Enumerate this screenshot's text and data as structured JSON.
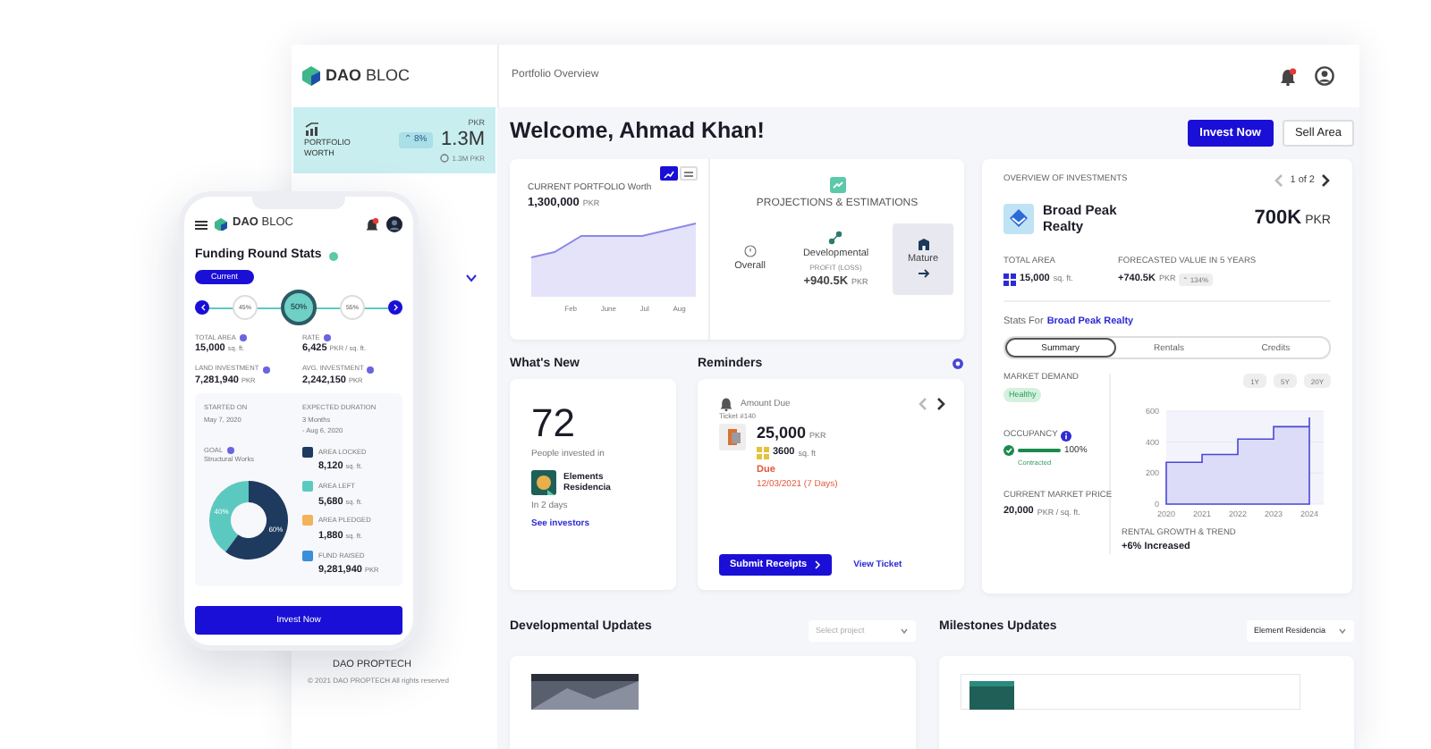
{
  "header": {
    "logo": "**DAO** BLOC",
    "breadcrumb": "Portfolio Overview"
  },
  "portfolio_worth": {
    "label": "PORTFOLIO WORTH",
    "change": "⌃ 8%",
    "currency": "PKR",
    "value": "1.3M",
    "sub_value": "1.3M PKR"
  },
  "sidebar_footer": {
    "brand": "DAO PROPTECH",
    "copyright": "© 2021 DAO PROPTECH All rights reserved"
  },
  "welcome": "Welcome, Ahmad Khan!",
  "actions": [
    {
      "label": "Invest Now",
      "kind": "primary"
    },
    {
      "label": "Sell Area",
      "kind": "secondary"
    }
  ],
  "portfolio_chart": {
    "view_toggle": [
      {
        "kind": "chart",
        "selected": true
      },
      {
        "kind": "list",
        "selected": false
      }
    ],
    "title": "CURRENT PORTFOLIO Worth",
    "value": "1,300,000",
    "currency": "PKR",
    "x_labels": [
      "Feb",
      "June",
      "Jul",
      "Aug"
    ]
  },
  "projections": {
    "title": "PROJECTIONS & ESTIMATIONS",
    "options": [
      {
        "label": "Overall",
        "kind": "overall",
        "selected": false
      },
      {
        "label": "Developmental",
        "kind": "developmental",
        "selected": false,
        "profit_label": "PROFIT (LOSS)",
        "profit_value": "+940.5K",
        "currency": "PKR"
      },
      {
        "label": "Mature",
        "kind": "mature",
        "selected": true
      }
    ]
  },
  "overview": {
    "title": "OVERVIEW OF INVESTMENTS",
    "pager": "1 of 2",
    "name": "Broad Peak Realty",
    "value": "700K",
    "currency": "PKR",
    "total_area_label": "TOTAL AREA",
    "total_area": "15,000",
    "total_area_unit": "sq. ft.",
    "forecast_label": "FORECASTED VALUE IN 5 YEARS",
    "forecast": "+740.5K",
    "forecast_unit": "PKR",
    "forecast_change": "⌃ 134%",
    "stats_prefix": "Stats For",
    "stats_link": "Broad Peak Realty",
    "tabs": [
      {
        "label": "Summary",
        "selected": true
      },
      {
        "label": "Rentals",
        "selected": false
      },
      {
        "label": "Credits",
        "selected": false
      }
    ],
    "market_demand_label": "MARKET DEMAND",
    "market_demand": "Healthy",
    "occupancy_label": "OCCUPANCY",
    "occupancy": {
      "level": 1,
      "reading": "100%",
      "status": "Contracted"
    },
    "price_label": "CURRENT MARKET PRICE",
    "price": "20,000",
    "price_unit": "PKR / sq. ft.",
    "ranges": [
      {
        "label": "1Y",
        "selected": false
      },
      {
        "label": "5Y",
        "selected": false
      },
      {
        "label": "20Y",
        "selected": false
      }
    ],
    "chart_data": {
      "type": "area",
      "x": [
        2020,
        2021,
        2022,
        2023,
        2024
      ],
      "values": [
        270,
        320,
        420,
        500,
        560
      ],
      "xlim": [
        2020,
        2024.4
      ],
      "ylim": [
        0,
        600
      ],
      "yticks": [
        0,
        200,
        400,
        600
      ],
      "xticks": [
        2020,
        2021,
        2022,
        2023,
        2024
      ]
    },
    "trend_label": "RENTAL GROWTH & TREND",
    "trend": "+6% Increased"
  },
  "whats_new": {
    "title": "What's New",
    "count": "72",
    "caption": "People invested in",
    "project": "Elements Residencia",
    "when": "In 2 days",
    "link": "See investors"
  },
  "reminders": {
    "title": "Reminders",
    "type": "Amount Due",
    "ticket": "Ticket #140",
    "amount": "25,000",
    "currency": "PKR",
    "area": "3600",
    "area_unit": "sq. ft",
    "status": "Due",
    "due_date": "12/03/2021 (7 Days)",
    "primary": "Submit Receipts",
    "secondary": "View Ticket"
  },
  "updates": [
    {
      "title": "Developmental Updates",
      "select": {
        "placeholder": "Select project"
      }
    },
    {
      "title": "Milestones Updates",
      "select": {
        "value": "Element Residencia"
      }
    }
  ],
  "phone": {
    "logo": "**DAO** BLOC",
    "title": "Funding Round Stats",
    "current": "Current",
    "steps": [
      {
        "label": "45%",
        "selected": false
      },
      {
        "label": "50%",
        "selected": true
      },
      {
        "label": "55%",
        "selected": false
      }
    ],
    "stats": [
      {
        "label": "TOTAL AREA",
        "value": "15,000",
        "unit": "sq. ft."
      },
      {
        "label": "RATE",
        "value": "6,425",
        "unit": "PKR / sq. ft."
      },
      {
        "label": "LAND INVESTMENT",
        "value": "7,281,940",
        "unit": "PKR"
      },
      {
        "label": "AVG. INVESTMENT",
        "value": "2,242,150",
        "unit": "PKR"
      }
    ],
    "started_label": "STARTED ON",
    "started": "May 7, 2020",
    "duration_label": "EXPECTED DURATION",
    "duration": "3 Months",
    "duration_end": "- Aug 6, 2020",
    "goal_label": "GOAL",
    "goal": "Structural Works",
    "legend": [
      {
        "label": "AREA LOCKED",
        "value": "8,120",
        "unit": "sq. ft.",
        "color": "#1f3a5f"
      },
      {
        "label": "AREA LEFT",
        "value": "5,680",
        "unit": "sq. ft.",
        "color": "#5cc9c0"
      },
      {
        "label": "AREA PLEDGED",
        "value": "1,880",
        "unit": "sq. ft.",
        "color": "#f2b35a"
      },
      {
        "label": "FUND RAISED",
        "value": "9,281,940",
        "unit": "PKR",
        "color": "#3a8fd8"
      }
    ],
    "chart_data": {
      "type": "donut",
      "values": [
        40,
        60
      ],
      "value_labels": [
        "40%",
        "60%"
      ]
    },
    "button": "Invest Now"
  }
}
